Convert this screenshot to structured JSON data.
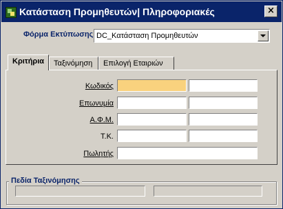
{
  "window": {
    "title": "Κατάσταση Προμηθευτών| Πληροφοριακές",
    "close_glyph": "×"
  },
  "print_form": {
    "label": "Φόρμα Εκτύπωσης",
    "selected": "DC_Κατάσταση Προμηθευτών"
  },
  "tabs": [
    {
      "label": "Κριτήρια",
      "active": true
    },
    {
      "label": "Ταξινόμηση",
      "active": false
    },
    {
      "label": "Επιλογή Εταιριών",
      "active": false
    }
  ],
  "criteria": {
    "code_label": "Κωδικός",
    "name_label": "Επωνυμία",
    "afm_label": "Α.Φ.Μ.",
    "tk_label": "Τ.Κ.",
    "salesman_label": "Πωλητής",
    "code_from": "",
    "code_to": "",
    "name_from": "",
    "name_to": "",
    "afm_from": "",
    "afm_to": "",
    "tk_from": "",
    "tk_to": "",
    "salesman": ""
  },
  "sort_fields": {
    "title": "Πεδία Ταξινόμησης",
    "field1": "",
    "field2": ""
  },
  "colors": {
    "title_bar": "#0a246a",
    "highlight_field": "#f9d27e",
    "label_accent": "#0a246a"
  }
}
